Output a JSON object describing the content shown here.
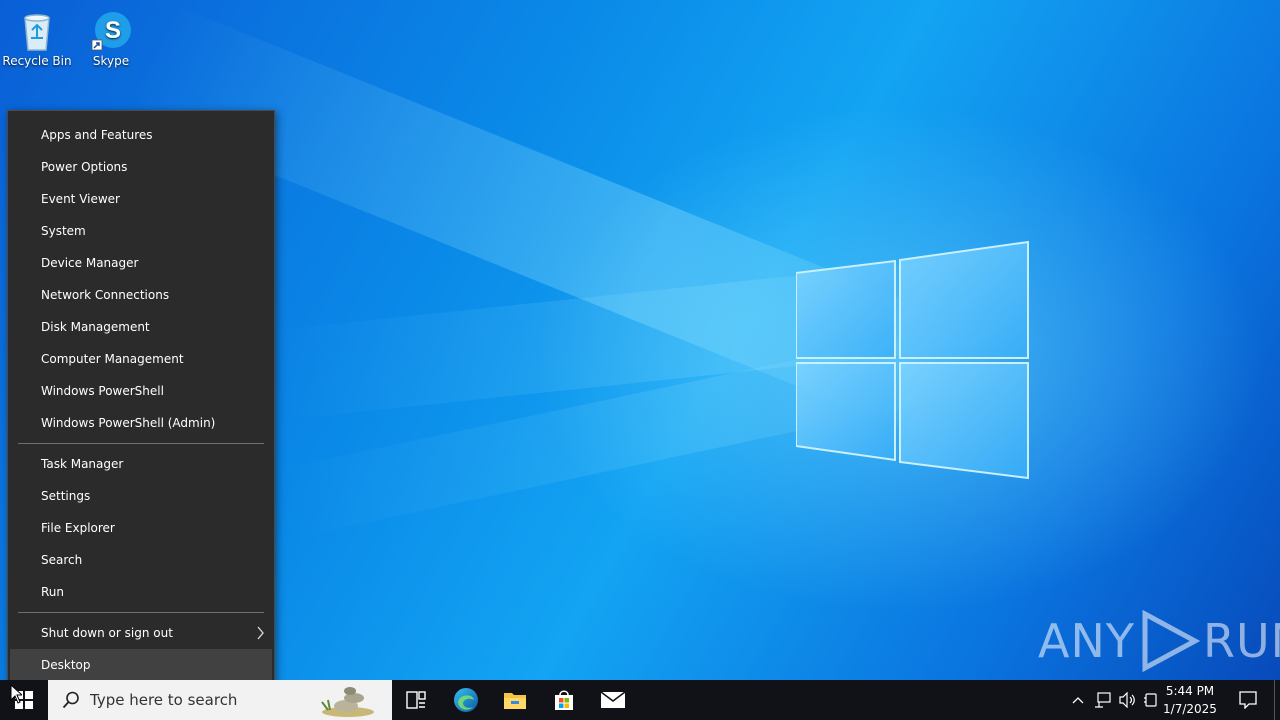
{
  "desktop": {
    "icons": [
      {
        "label": "Recycle Bin",
        "icon": "recycle-bin-icon"
      },
      {
        "label": "Skype",
        "icon": "skype-icon"
      }
    ]
  },
  "context_menu": {
    "group1": [
      {
        "label": "Apps and Features"
      },
      {
        "label": "Power Options"
      },
      {
        "label": "Event Viewer"
      },
      {
        "label": "System"
      },
      {
        "label": "Device Manager"
      },
      {
        "label": "Network Connections"
      },
      {
        "label": "Disk Management"
      },
      {
        "label": "Computer Management"
      },
      {
        "label": "Windows PowerShell"
      },
      {
        "label": "Windows PowerShell (Admin)"
      }
    ],
    "group2": [
      {
        "label": "Task Manager"
      },
      {
        "label": "Settings"
      },
      {
        "label": "File Explorer"
      },
      {
        "label": "Search"
      },
      {
        "label": "Run"
      }
    ],
    "group3": [
      {
        "label": "Shut down or sign out",
        "submenu": true
      },
      {
        "label": "Desktop",
        "highlighted": true
      }
    ]
  },
  "taskbar": {
    "search_placeholder": "Type here to search",
    "pinned": [
      "task-view-icon",
      "edge-icon",
      "file-explorer-icon",
      "store-icon",
      "mail-icon"
    ],
    "clock": {
      "time": "5:44 PM",
      "date": "1/7/2025"
    },
    "tray_icons": [
      "chevron-up-icon",
      "network-icon",
      "volume-icon",
      "tablet-icon"
    ]
  },
  "watermark": {
    "left": "ANY",
    "right": "RUN"
  },
  "colors": {
    "menu_bg": "#2b2b2b",
    "menu_highlight": "#414141",
    "taskbar_bg": "#111217",
    "desktop_accent": "#0a8ae8"
  }
}
